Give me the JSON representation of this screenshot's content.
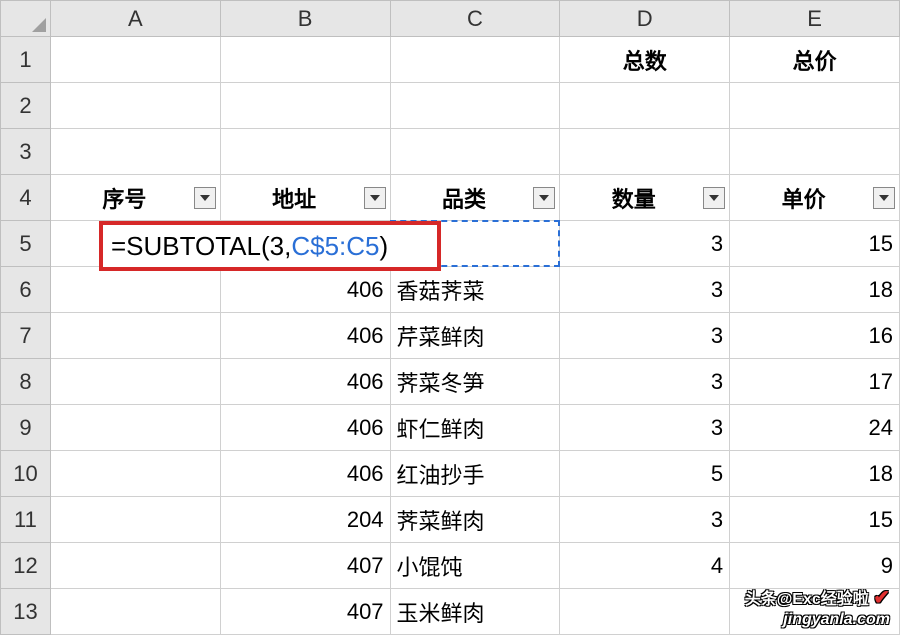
{
  "columns": [
    "A",
    "B",
    "C",
    "D",
    "E"
  ],
  "row_numbers": [
    1,
    2,
    3,
    4,
    5,
    6,
    7,
    8,
    9,
    10,
    11,
    12,
    13
  ],
  "headers_teal": {
    "d1": "总数",
    "e1": "总价"
  },
  "table_headers": {
    "a": "序号",
    "b": "地址",
    "c": "品类",
    "d": "数量",
    "e": "单价"
  },
  "formula": {
    "prefix": "=SUBTOTAL(3,",
    "ref": "C$5:C5",
    "suffix": ")"
  },
  "row5": {
    "d": "3",
    "e": "15"
  },
  "rows": [
    {
      "b": "406",
      "c": "香菇荠菜",
      "d": "3",
      "e": "18"
    },
    {
      "b": "406",
      "c": "芹菜鲜肉",
      "d": "3",
      "e": "16"
    },
    {
      "b": "406",
      "c": "荠菜冬笋",
      "d": "3",
      "e": "17"
    },
    {
      "b": "406",
      "c": "虾仁鲜肉",
      "d": "3",
      "e": "24"
    },
    {
      "b": "406",
      "c": "红油抄手",
      "d": "5",
      "e": "18"
    },
    {
      "b": "204",
      "c": "荠菜鲜肉",
      "d": "3",
      "e": "15"
    },
    {
      "b": "407",
      "c": "小馄饨",
      "d": "4",
      "e": "9"
    },
    {
      "b": "407",
      "c": "玉米鲜肉",
      "d": "",
      "e": ""
    }
  ],
  "watermark": {
    "line1": "头条@Exc经验啦",
    "brand": "jingyanla.com",
    "check": "✔"
  },
  "chart_data": {
    "type": "table",
    "columns": [
      "序号",
      "地址",
      "品类",
      "数量",
      "单价"
    ],
    "rows": [
      [
        null,
        406,
        "香菇荠菜",
        3,
        18
      ],
      [
        null,
        406,
        "芹菜鲜肉",
        3,
        16
      ],
      [
        null,
        406,
        "荠菜冬笋",
        3,
        17
      ],
      [
        null,
        406,
        "虾仁鲜肉",
        3,
        24
      ],
      [
        null,
        406,
        "红油抄手",
        5,
        18
      ],
      [
        null,
        204,
        "荠菜鲜肉",
        3,
        15
      ],
      [
        null,
        407,
        "小馄饨",
        4,
        9
      ],
      [
        null,
        407,
        "玉米鲜肉",
        null,
        null
      ]
    ],
    "summary_headers": [
      "总数",
      "总价"
    ],
    "formula_in_A5": "=SUBTOTAL(3,C$5:C5)"
  }
}
